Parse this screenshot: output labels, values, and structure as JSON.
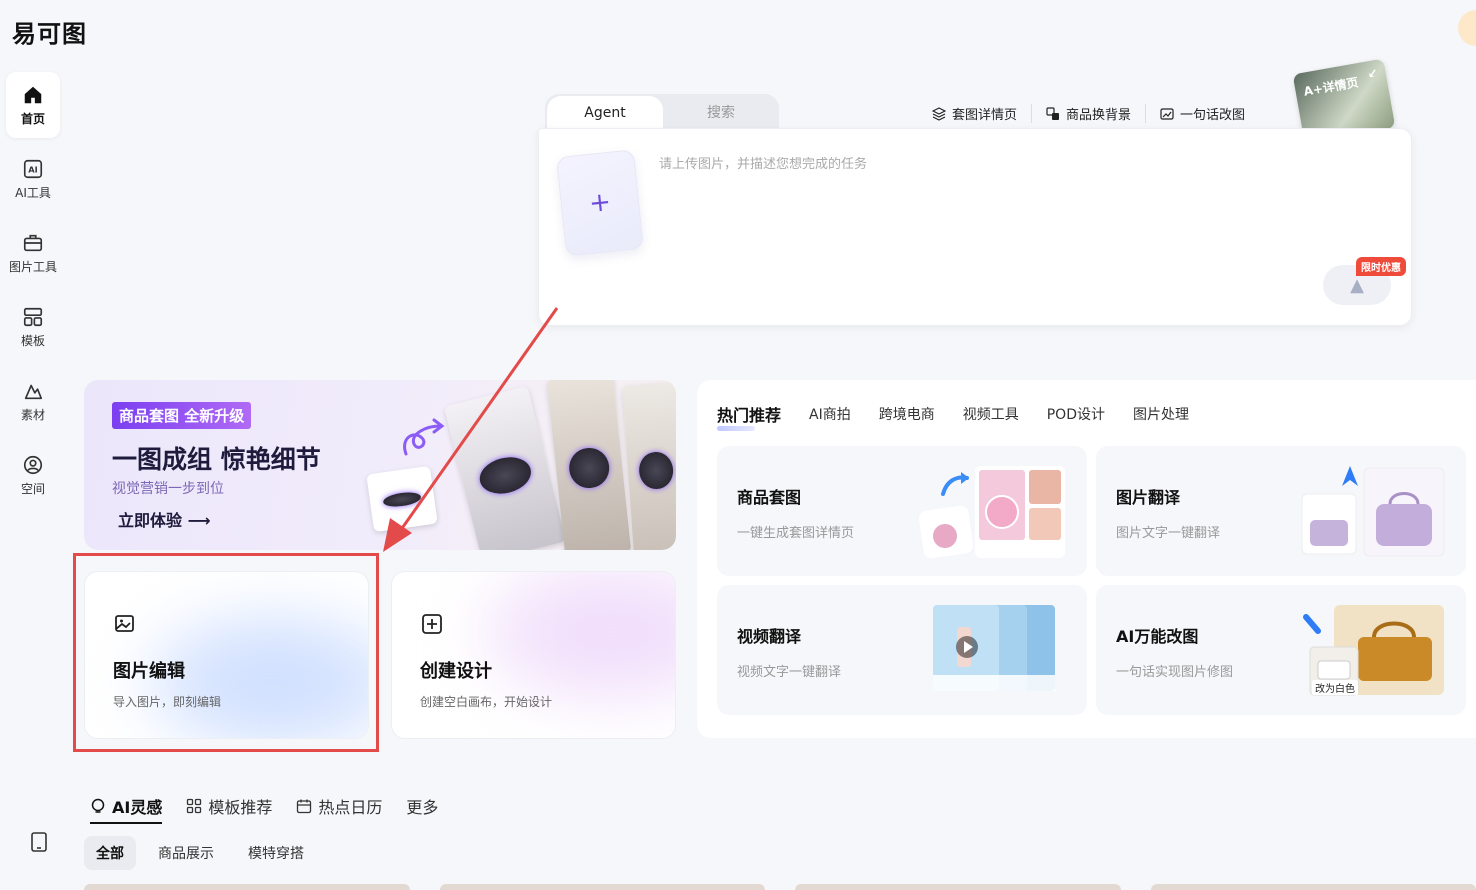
{
  "app": {
    "logo": "易可图"
  },
  "sidebar": {
    "items": [
      {
        "label": "首页",
        "icon": "home-icon",
        "active": true
      },
      {
        "label": "AI工具",
        "icon": "ai-icon"
      },
      {
        "label": "图片工具",
        "icon": "toolbox-icon"
      },
      {
        "label": "模板",
        "icon": "template-icon"
      },
      {
        "label": "素材",
        "icon": "shapes-icon"
      },
      {
        "label": "空间",
        "icon": "user-icon"
      }
    ]
  },
  "agent": {
    "tabs": [
      "Agent",
      "搜索"
    ],
    "placeholder": "请上传图片，并描述您想完成的任务",
    "promo": "限时优惠",
    "quick_links": [
      "套图详情页",
      "商品换背景",
      "一句话改图"
    ],
    "detail_card": "A+详情页"
  },
  "banner": {
    "tag": "商品套图 全新升级",
    "title": "一图成组 惊艳细节",
    "subtitle": "视觉营销一步到位",
    "cta": "立即体验 ⟶"
  },
  "hot": {
    "tabs": [
      "热门推荐",
      "AI商拍",
      "跨境电商",
      "视频工具",
      "POD设计",
      "图片处理"
    ],
    "tools": [
      {
        "title": "商品套图",
        "subtitle": "一键生成套图详情页"
      },
      {
        "title": "图片翻译",
        "subtitle": "图片文字一键翻译"
      },
      {
        "title": "视频翻译",
        "subtitle": "视频文字一键翻译"
      },
      {
        "title": "AI万能改图",
        "subtitle": "一句话实现图片修图",
        "badge": "改为白色"
      }
    ]
  },
  "actions": [
    {
      "title": "图片编辑",
      "subtitle": "导入图片，即刻编辑"
    },
    {
      "title": "创建设计",
      "subtitle": "创建空白画布，开始设计"
    }
  ],
  "inspire": {
    "tabs": [
      "AI灵感",
      "模板推荐",
      "热点日历",
      "更多"
    ],
    "filters": [
      "全部",
      "商品展示",
      "模特穿搭"
    ]
  },
  "colors": {
    "accent": "#7b3ff0",
    "highlight": "#e34a4a"
  }
}
